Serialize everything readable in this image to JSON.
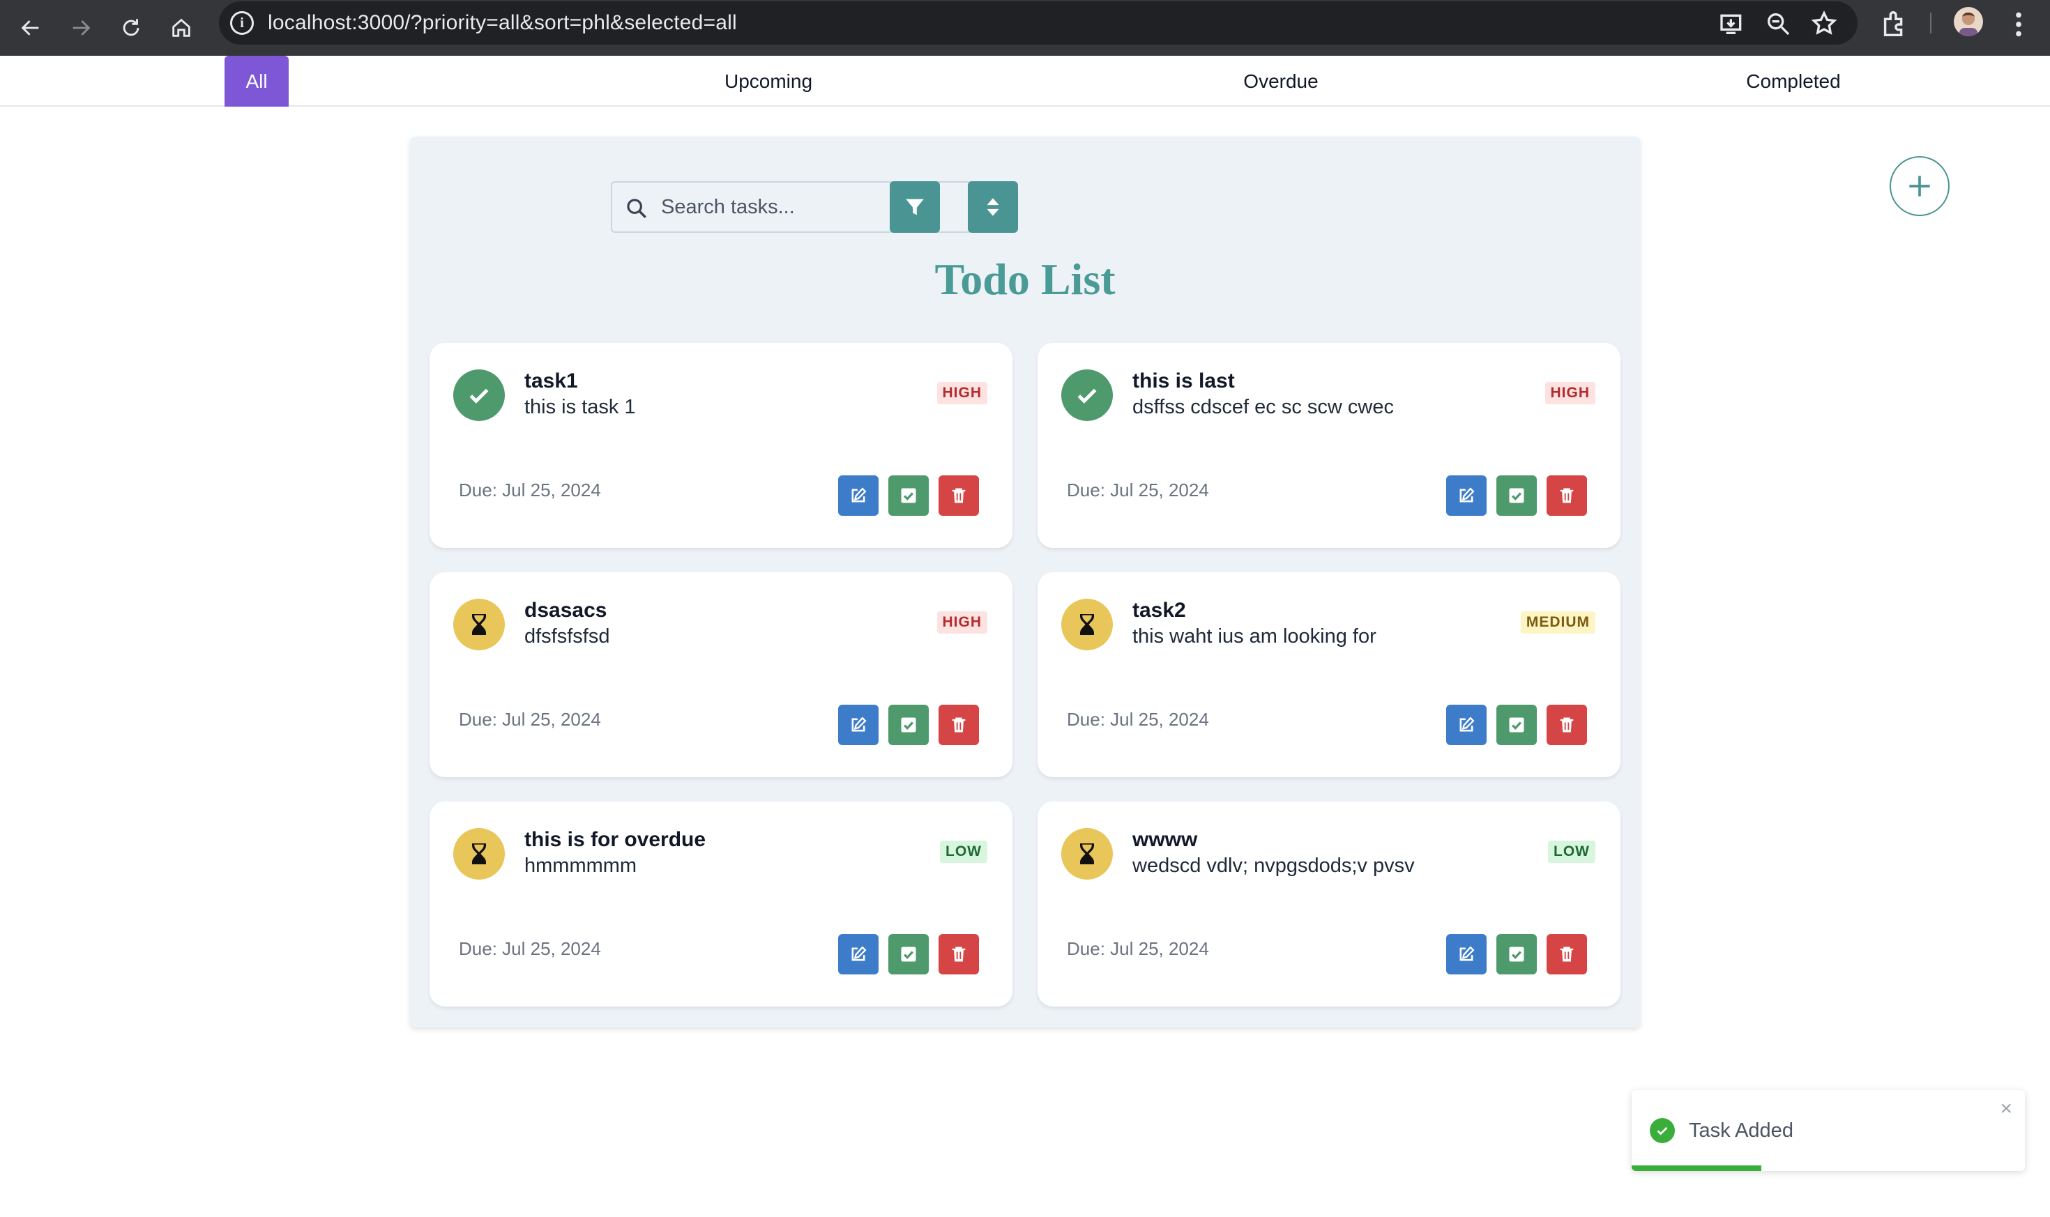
{
  "browser": {
    "url": "localhost:3000/?priority=all&sort=phl&selected=all"
  },
  "tabs": [
    {
      "label": "All",
      "active": true
    },
    {
      "label": "Upcoming",
      "active": false
    },
    {
      "label": "Overdue",
      "active": false
    },
    {
      "label": "Completed",
      "active": false
    }
  ],
  "search": {
    "placeholder": "Search tasks..."
  },
  "page_title": "Todo List",
  "tasks": [
    {
      "title": "task1",
      "description": "this is task 1",
      "priority": "HIGH",
      "due": "Due: Jul 25, 2024",
      "status": "completed"
    },
    {
      "title": "this is last",
      "description": "dsffss cdscef ec sc scw cwec",
      "priority": "HIGH",
      "due": "Due: Jul 25, 2024",
      "status": "completed"
    },
    {
      "title": "dsasacs",
      "description": "dfsfsfsfsd",
      "priority": "HIGH",
      "due": "Due: Jul 25, 2024",
      "status": "pending"
    },
    {
      "title": "task2",
      "description": "this waht ius am looking for",
      "priority": "MEDIUM",
      "due": "Due: Jul 25, 2024",
      "status": "pending"
    },
    {
      "title": "this is for overdue",
      "description": "hmmmmmm",
      "priority": "LOW",
      "due": "Due: Jul 25, 2024",
      "status": "pending"
    },
    {
      "title": "wwww",
      "description": "wedscd vdlv; nvpgsdods;v pvsv",
      "priority": "LOW",
      "due": "Due: Jul 25, 2024",
      "status": "pending"
    }
  ],
  "toast": {
    "message": "Task Added",
    "close": "×",
    "progress": 0.33
  },
  "colors": {
    "accent": "#7e57d6",
    "teal": "#4a9494",
    "done": "#4f9a6c",
    "pending": "#e8c65a",
    "edit": "#3d7cc9",
    "delete": "#d64545"
  }
}
